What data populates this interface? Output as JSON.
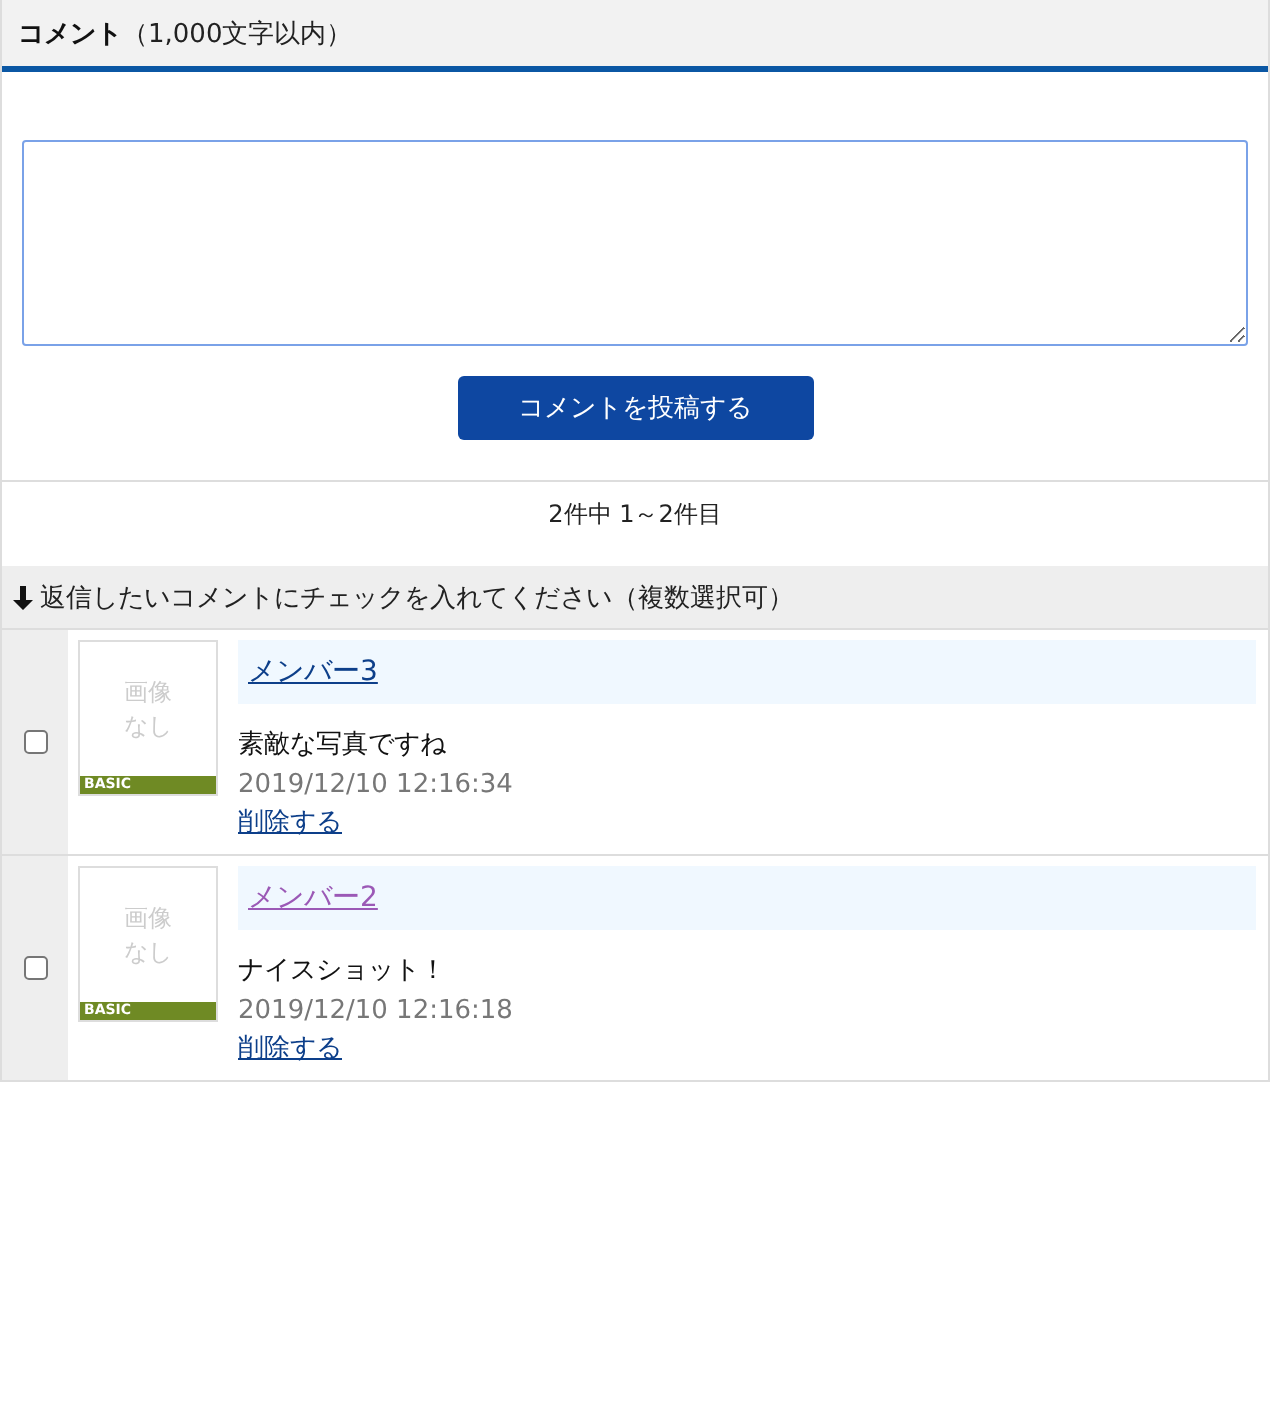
{
  "header": {
    "title": "コメント",
    "note": "（1,000文字以内）"
  },
  "submit_button": "コメントを投稿する",
  "count": "2件中 1～2件目",
  "instruction": "返信したいコメントにチェックを入れてください（複数選択可）",
  "comments": [
    {
      "checked": false,
      "thumb_text": "画像なし",
      "badge": "BASIC",
      "member": "メンバー3",
      "visited": false,
      "text": "素敵な写真ですね",
      "date": "2019/12/10 12:16:34",
      "delete": "削除する"
    },
    {
      "checked": false,
      "thumb_text": "画像なし",
      "badge": "BASIC",
      "member": "メンバー2",
      "visited": true,
      "text": "ナイスショット！",
      "date": "2019/12/10 12:16:18",
      "delete": "削除する"
    }
  ]
}
